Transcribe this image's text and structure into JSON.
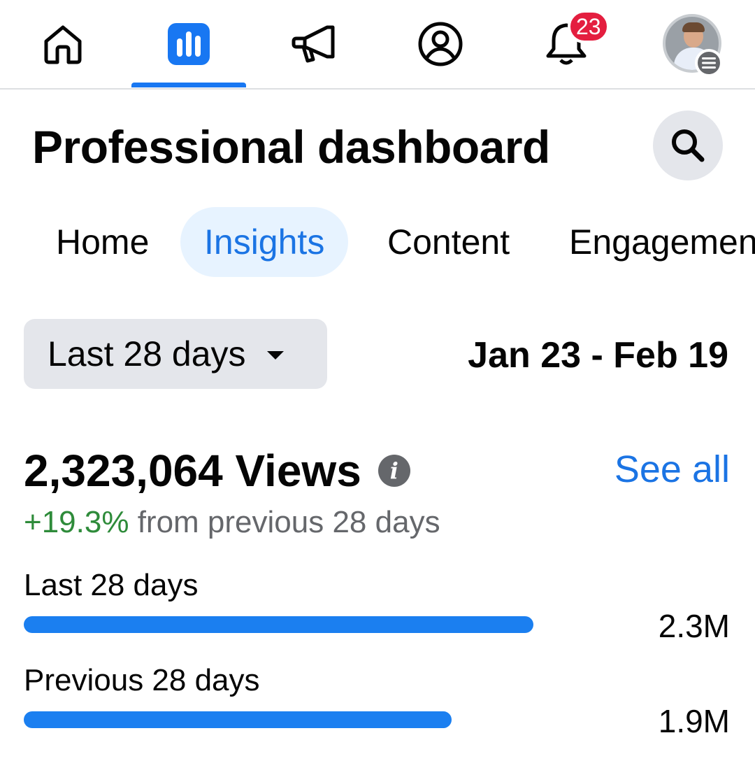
{
  "nav": {
    "items": [
      {
        "name": "home",
        "icon": "home-icon"
      },
      {
        "name": "insights",
        "icon": "bar-chart-icon",
        "active": true
      },
      {
        "name": "ads",
        "icon": "megaphone-icon"
      },
      {
        "name": "profile",
        "icon": "profile-icon"
      },
      {
        "name": "notifications",
        "icon": "bell-icon"
      },
      {
        "name": "menu",
        "icon": "avatar"
      }
    ],
    "notification_count": "23",
    "accent_color": "#1877f2",
    "badge_color": "#e41e3f"
  },
  "header": {
    "title": "Professional dashboard",
    "search_icon": "search-icon"
  },
  "tabs": [
    {
      "label": "Home",
      "active": false
    },
    {
      "label": "Insights",
      "active": true
    },
    {
      "label": "Content",
      "active": false
    },
    {
      "label": "Engagement",
      "active": false
    }
  ],
  "range": {
    "selected": "Last 28 days",
    "dates": "Jan 23 - Feb 19"
  },
  "views": {
    "count_text": "2,323,064 Views",
    "see_all": "See all",
    "change_pct": "+19.3%",
    "change_text": "from previous 28 days"
  },
  "comparison": [
    {
      "label": "Last 28 days",
      "value_text": "2.3M",
      "value": 2323064,
      "fill_fraction": 0.81
    },
    {
      "label": "Previous 28 days",
      "value_text": "1.9M",
      "value": 1947000,
      "fill_fraction": 0.68
    }
  ]
}
